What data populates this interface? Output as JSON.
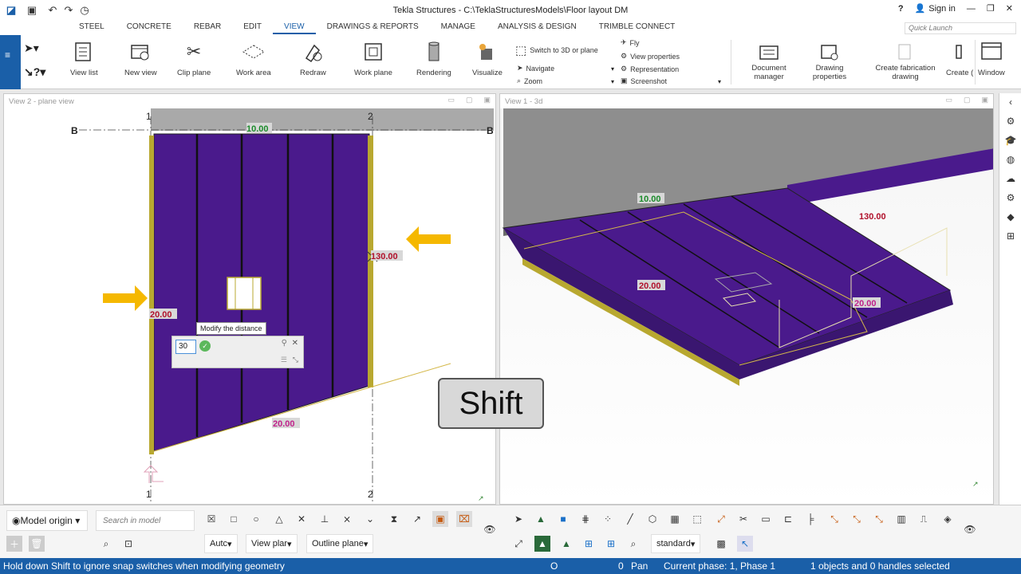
{
  "app": {
    "title": "Tekla Structures - C:\\TeklaStructuresModels\\Floor layout DM",
    "sign_in": "Sign in"
  },
  "menu": {
    "tabs": [
      "STEEL",
      "CONCRETE",
      "REBAR",
      "EDIT",
      "VIEW",
      "DRAWINGS & REPORTS",
      "MANAGE",
      "ANALYSIS & DESIGN",
      "TRIMBLE CONNECT"
    ],
    "active": "VIEW",
    "quick_launch_placeholder": "Quick Launch"
  },
  "ribbon": {
    "view_list": "View list",
    "new_view": "New view",
    "clip_plane": "Clip plane",
    "work_area": "Work area",
    "redraw": "Redraw",
    "work_plane": "Work plane",
    "rendering": "Rendering",
    "visualize": "Visualize",
    "switch_3d": "Switch to 3D or plane",
    "navigate": "Navigate",
    "zoom": "Zoom",
    "fly": "Fly",
    "view_properties": "View properties",
    "representation": "Representation",
    "screenshot": "Screenshot",
    "document_manager": "Document manager",
    "drawing_properties": "Drawing properties",
    "create_fabrication_drawing": "Create fabrication drawing",
    "create": "Create (",
    "window": "Window"
  },
  "views": {
    "left": {
      "title": "View 2 - plane view",
      "grid_left": "1",
      "grid_right": "2",
      "grid_b": "B",
      "dim_top": "10.00",
      "dim_right": "130.00",
      "dim_left": "20.00",
      "dim_bottom": "20.00"
    },
    "right": {
      "title": "View 1 - 3d",
      "dim_top": "10.00",
      "dim_right": "130.00",
      "dim_left": "20.00",
      "dim_bottom": "20.00"
    }
  },
  "overlay": {
    "tooltip": "Modify the distance",
    "distance_value": "30",
    "shift_key": "Shift"
  },
  "bottom": {
    "model_origin": "Model origin",
    "search_placeholder": "Search in model",
    "auto": "Autc",
    "view_plane": "View plar",
    "outline_plane": "Outline plane",
    "standard": "standard"
  },
  "status": {
    "hint": "Hold down Shift to ignore snap switches when modifying geometry",
    "o": "O",
    "zero": "0",
    "pan": "Pan",
    "phase": "Current phase: 1, Phase 1",
    "selection": "1 objects and 0 handles selected"
  },
  "colors": {
    "accent": "#1a5fa8",
    "slab": "#4a1a8c",
    "edge": "#b8a830",
    "arrow": "#f5b800",
    "dim_green": "#1a8a2a",
    "dim_red": "#b0102a",
    "dim_magenta": "#c0208a"
  }
}
